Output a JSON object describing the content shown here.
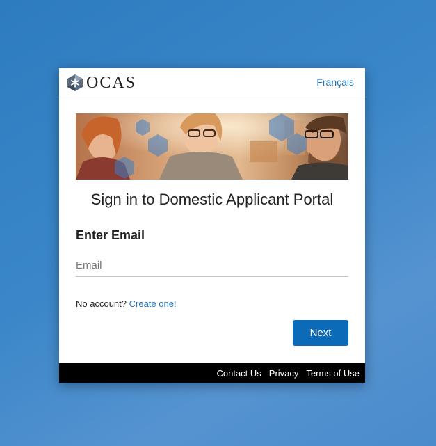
{
  "brand": {
    "logo_text": "OCAS"
  },
  "header": {
    "language_link": "Français"
  },
  "main": {
    "title": "Sign in to Domestic Applicant Portal",
    "section_title": "Enter Email",
    "email_placeholder": "Email",
    "email_value": "",
    "no_account_text": "No account?",
    "create_link": "Create one!",
    "next_label": "Next"
  },
  "footer": {
    "links": [
      "Contact Us",
      "Privacy",
      "Terms of Use"
    ]
  },
  "colors": {
    "accent": "#0b6bb8",
    "link": "#1e73be",
    "footer_bg": "#000000",
    "background": "#3a86c8"
  },
  "icons": [
    "ocas-logo-icon"
  ]
}
